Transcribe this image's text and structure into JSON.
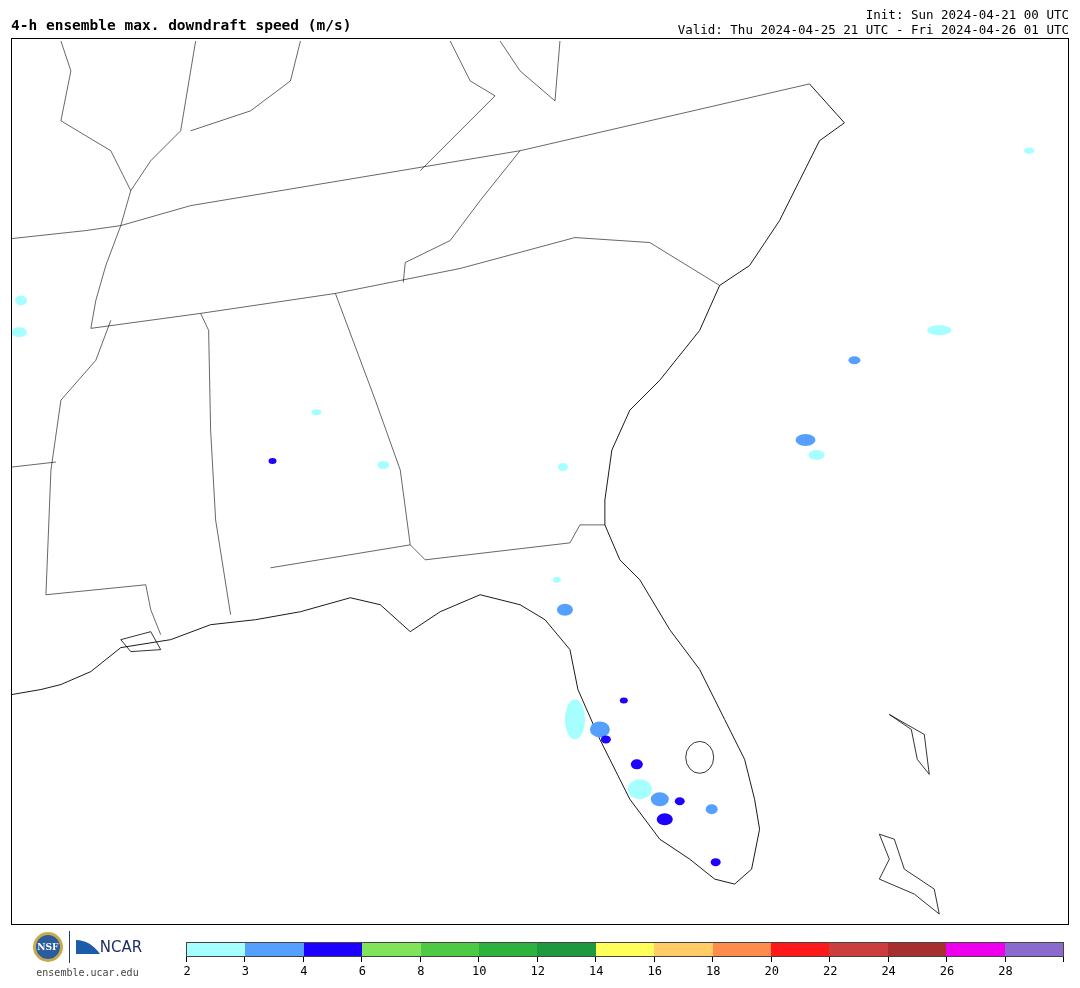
{
  "header": {
    "title": "4-h ensemble max. downdraft speed (m/s)",
    "init": "Init: Sun 2024-04-21 00 UTC",
    "valid": "Valid: Thu 2024-04-25 21 UTC - Fri 2024-04-26 01 UTC"
  },
  "logos": {
    "nsf": "NSF",
    "ncar": "NCAR",
    "url": "ensemble.ucar.edu"
  },
  "colorbar": {
    "segments": [
      {
        "color": "#a6ffff"
      },
      {
        "color": "#559fff"
      },
      {
        "color": "#1e00ff"
      },
      {
        "color": "#80e45a"
      },
      {
        "color": "#4dc944"
      },
      {
        "color": "#2db33d"
      },
      {
        "color": "#1f993f"
      },
      {
        "color": "#ffff5c"
      },
      {
        "color": "#ffcc66"
      },
      {
        "color": "#ff8c4d"
      },
      {
        "color": "#ff1a1a"
      },
      {
        "color": "#cc3d3d"
      },
      {
        "color": "#a63030"
      },
      {
        "color": "#ee00ee"
      },
      {
        "color": "#8a6acc"
      }
    ],
    "ticks": [
      "2",
      "3",
      "4",
      "6",
      "8",
      "10",
      "12",
      "14",
      "16",
      "18",
      "20",
      "22",
      "24",
      "26",
      "28"
    ]
  }
}
